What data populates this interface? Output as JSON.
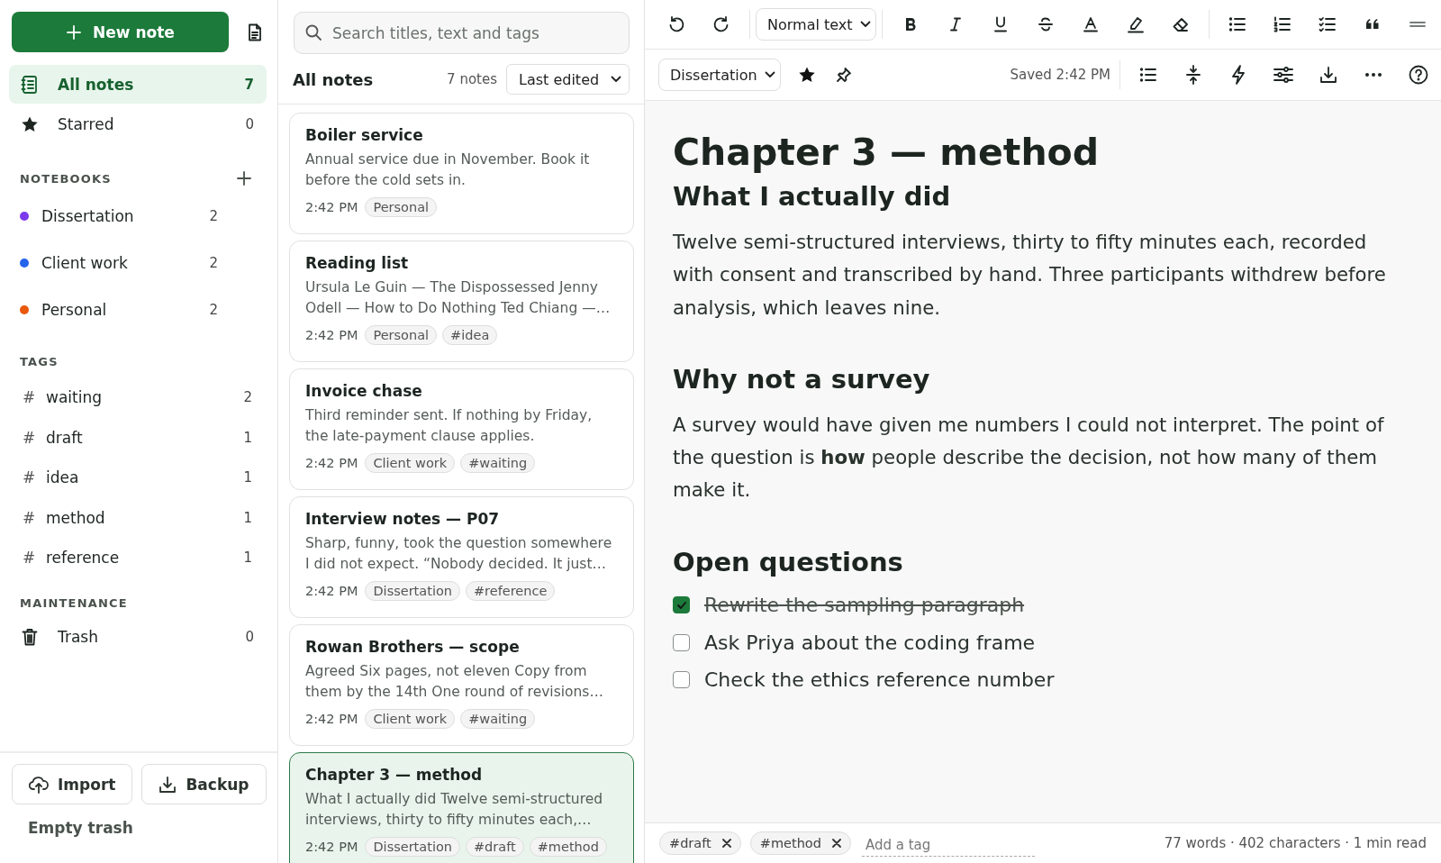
{
  "sidebar": {
    "new_note_button": "New note",
    "nav": [
      {
        "kind": "all",
        "label": "All notes",
        "count": "7",
        "selected": true
      },
      {
        "kind": "starred",
        "label": "Starred",
        "count": "0",
        "selected": false
      }
    ],
    "notebooks_heading": "NOTEBOOKS",
    "notebooks": [
      {
        "name": "Dissertation",
        "count": "2",
        "color": "#7c3aed"
      },
      {
        "name": "Client work",
        "count": "2",
        "color": "#2563eb"
      },
      {
        "name": "Personal",
        "count": "2",
        "color": "#ea580c"
      }
    ],
    "tags_heading": "TAGS",
    "tags": [
      {
        "symbol": "#",
        "label": "waiting",
        "count": "2"
      },
      {
        "symbol": "#",
        "label": "draft",
        "count": "1"
      },
      {
        "symbol": "#",
        "label": "idea",
        "count": "1"
      },
      {
        "symbol": "#",
        "label": "method",
        "count": "1"
      },
      {
        "symbol": "#",
        "label": "reference",
        "count": "1"
      }
    ],
    "maintenance_heading": "MAINTENANCE",
    "trash": {
      "label": "Trash",
      "count": "0"
    },
    "import_button": "Import",
    "backup_button": "Backup",
    "empty_trash_button": "Empty trash"
  },
  "note_list": {
    "search": {
      "placeholder": "Search titles, text and tags"
    },
    "title": "All notes",
    "count": "7 notes",
    "sort": "Last edited",
    "notes": [
      {
        "title": "Boiler service",
        "snippet": "Annual service due in November. Book it before the cold sets in.",
        "time": "2:42 PM",
        "tags": [
          "Personal"
        ],
        "selected": false
      },
      {
        "title": "Reading list",
        "snippet": "Ursula Le Guin — The Dispossessed Jenny Odell — How to Do Nothing Ted Chiang —…",
        "time": "2:42 PM",
        "tags": [
          "Personal",
          "#idea"
        ],
        "selected": false
      },
      {
        "title": "Invoice chase",
        "snippet": "Third reminder sent. If nothing by Friday, the late-payment clause applies.",
        "time": "2:42 PM",
        "tags": [
          "Client work",
          "#waiting"
        ],
        "selected": false
      },
      {
        "title": "Interview notes — P07",
        "snippet": "Sharp, funny, took the question somewhere I did not expect. “Nobody decided. It just…",
        "time": "2:42 PM",
        "tags": [
          "Dissertation",
          "#reference"
        ],
        "selected": false
      },
      {
        "title": "Rowan Brothers — scope",
        "snippet": "Agreed Six pages, not eleven Copy from them by the 14th One round of revisions…",
        "time": "2:42 PM",
        "tags": [
          "Client work",
          "#waiting"
        ],
        "selected": false
      },
      {
        "title": "Chapter 3 — method",
        "snippet": "What I actually did Twelve semi-structured interviews, thirty to fifty minutes each,…",
        "time": "2:42 PM",
        "tags": [
          "Dissertation",
          "#draft",
          "#method"
        ],
        "selected": true
      }
    ]
  },
  "editor": {
    "format": "Normal text",
    "notebook": "Dissertation",
    "starred": true,
    "saved": "Saved 2:42 PM",
    "document": [
      {
        "kind": "h1",
        "text": "Chapter 3 — method"
      },
      {
        "kind": "h2",
        "text": "What I actually did"
      },
      {
        "kind": "p",
        "text": "Twelve semi-structured interviews, thirty to fifty minutes each, recorded with consent and transcribed by hand. Three participants withdrew before analysis, which leaves nine."
      },
      {
        "kind": "h2",
        "text": "Why not a survey"
      },
      {
        "kind": "p",
        "text": "A survey would have given me numbers I could not interpret. The point of the question is **how** people describe the decision, not how many of them make it."
      },
      {
        "kind": "h2",
        "text": "Open questions"
      },
      {
        "kind": "task",
        "text": "Rewrite the sampling paragraph",
        "checked": true
      },
      {
        "kind": "task",
        "text": "Ask Priya about the coding frame",
        "checked": false
      },
      {
        "kind": "task",
        "text": "Check the ethics reference number",
        "checked": false
      }
    ],
    "tags": [
      "#draft",
      "#method"
    ],
    "tag_input": {
      "placeholder": "Add a tag"
    },
    "stats": "77 words · 402 characters · 1 min read"
  }
}
